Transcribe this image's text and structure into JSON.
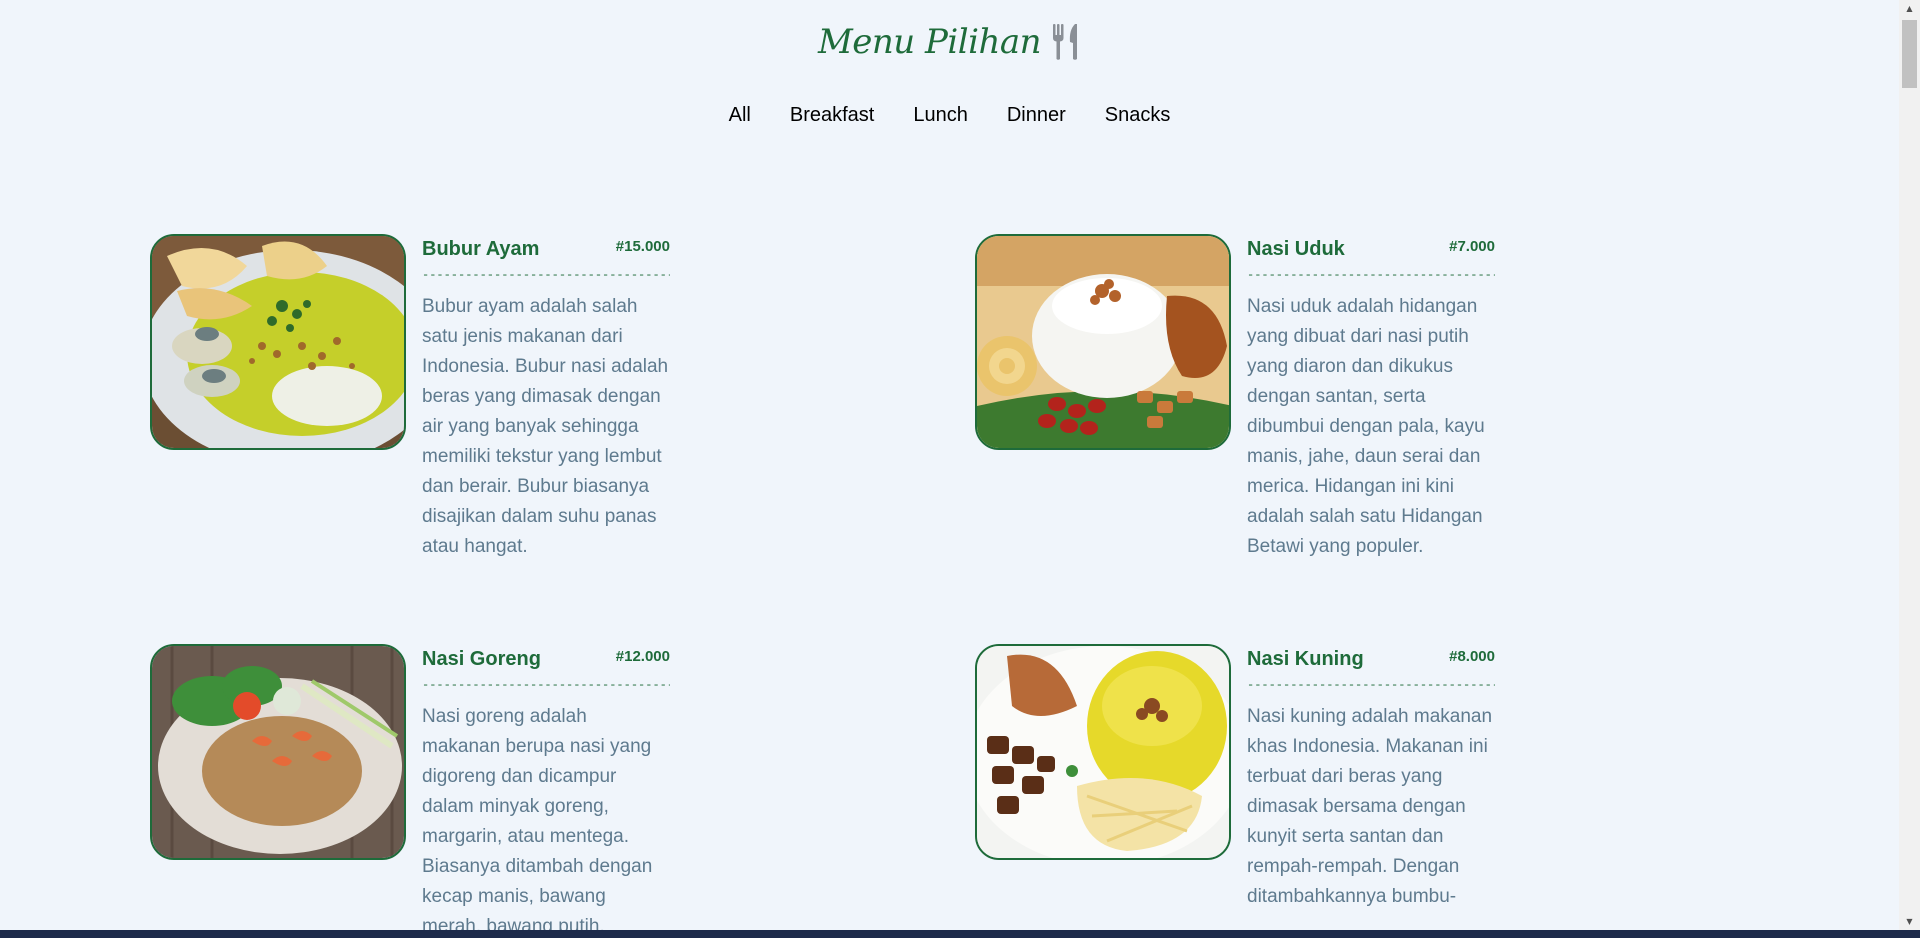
{
  "header": {
    "title": "Menu Pilihan",
    "icon": "fork-knife-icon"
  },
  "nav": {
    "items": [
      "All",
      "Breakfast",
      "Lunch",
      "Dinner",
      "Snacks"
    ]
  },
  "menu": [
    {
      "name": "Bubur Ayam",
      "price": "#15.000",
      "divider": "-----------------------------------",
      "description": "Bubur ayam adalah salah satu jenis makanan dari Indonesia. Bubur nasi adalah beras yang dimasak dengan air yang banyak sehingga memiliki tekstur yang lembut dan berair. Bubur biasanya disajikan dalam suhu panas atau hangat."
    },
    {
      "name": "Nasi Uduk",
      "price": "#7.000",
      "divider": "-----------------------------------",
      "description": "Nasi uduk adalah hidangan yang dibuat dari nasi putih yang diaron dan dikukus dengan santan, serta dibumbui dengan pala, kayu manis, jahe, daun serai dan merica. Hidangan ini kini adalah salah satu Hidangan Betawi yang populer."
    },
    {
      "name": "Nasi Goreng",
      "price": "#12.000",
      "divider": "-----------------------------------",
      "description": "Nasi goreng adalah makanan berupa nasi yang digoreng dan dicampur dalam minyak goreng, margarin, atau mentega. Biasanya ditambah dengan kecap manis, bawang merah, bawang putih,"
    },
    {
      "name": "Nasi Kuning",
      "price": "#8.000",
      "divider": "-----------------------------------",
      "description": "Nasi kuning adalah makanan khas Indonesia. Makanan ini terbuat dari beras yang dimasak bersama dengan kunyit serta santan dan rempah-rempah. Dengan ditambahkannya bumbu-"
    }
  ],
  "colors": {
    "accent": "#1e6b3a",
    "background": "#f0f5fb",
    "description_text": "#5e7a8e"
  }
}
